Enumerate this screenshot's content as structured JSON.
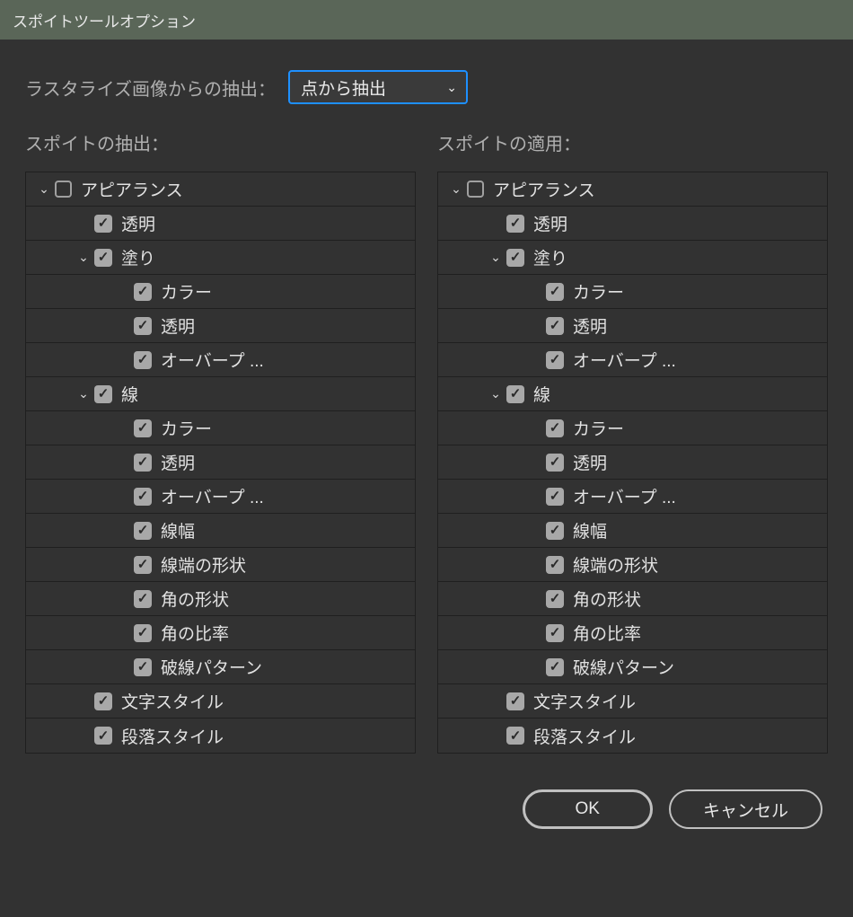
{
  "title": "スポイトツールオプション",
  "raster": {
    "label": "ラスタライズ画像からの抽出：",
    "value": "点から抽出"
  },
  "columns": {
    "left_header": "スポイトの抽出：",
    "right_header": "スポイトの適用："
  },
  "tree": [
    {
      "indent": 0,
      "expander": true,
      "checked": false,
      "empty": true,
      "label": "アピアランス"
    },
    {
      "indent": 1,
      "expander": false,
      "checked": true,
      "label": "透明"
    },
    {
      "indent": 1,
      "expander": true,
      "checked": true,
      "label": "塗り"
    },
    {
      "indent": 2,
      "expander": false,
      "checked": true,
      "label": "カラー"
    },
    {
      "indent": 2,
      "expander": false,
      "checked": true,
      "label": "透明"
    },
    {
      "indent": 2,
      "expander": false,
      "checked": true,
      "label": "オーバープ ..."
    },
    {
      "indent": 1,
      "expander": true,
      "checked": true,
      "label": "線"
    },
    {
      "indent": 2,
      "expander": false,
      "checked": true,
      "label": "カラー"
    },
    {
      "indent": 2,
      "expander": false,
      "checked": true,
      "label": "透明"
    },
    {
      "indent": 2,
      "expander": false,
      "checked": true,
      "label": "オーバープ ..."
    },
    {
      "indent": 2,
      "expander": false,
      "checked": true,
      "label": "線幅"
    },
    {
      "indent": 2,
      "expander": false,
      "checked": true,
      "label": "線端の形状"
    },
    {
      "indent": 2,
      "expander": false,
      "checked": true,
      "label": "角の形状"
    },
    {
      "indent": 2,
      "expander": false,
      "checked": true,
      "label": "角の比率"
    },
    {
      "indent": 2,
      "expander": false,
      "checked": true,
      "label": "破線パターン"
    },
    {
      "indent": 1,
      "expander": false,
      "checked": true,
      "label": "文字スタイル"
    },
    {
      "indent": 1,
      "expander": false,
      "checked": true,
      "label": "段落スタイル"
    }
  ],
  "buttons": {
    "ok": "OK",
    "cancel": "キャンセル"
  }
}
